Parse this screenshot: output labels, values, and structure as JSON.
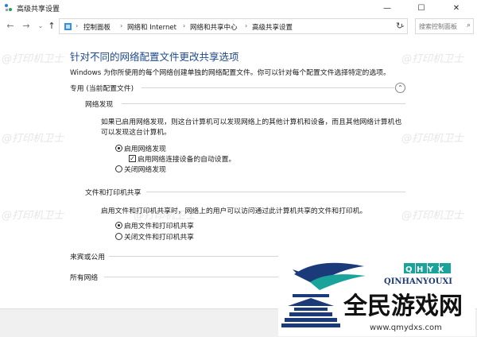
{
  "window": {
    "title": "高级共享设置",
    "minimize": "—",
    "maximize": "☐",
    "close": "✕"
  },
  "nav": {
    "back": "←",
    "forward": "→",
    "recent": "⌄",
    "up": "↑",
    "breadcrumbs": [
      "控制面板",
      "网络和 Internet",
      "网络和共享中心",
      "高级共享设置"
    ],
    "separator": "›",
    "dropdown": "⌄",
    "refresh": "↻",
    "search_placeholder": "搜索控制面板",
    "search_icon": "⌕"
  },
  "main": {
    "heading": "针对不同的网络配置文件更改共享选项",
    "description": "Windows 为你所使用的每个网络创建单独的网络配置文件。你可以针对每个配置文件选择特定的选项。",
    "profile_private": {
      "label": "专用 (当前配置文件)",
      "collapse_icon": "⌃",
      "network_discovery": {
        "label": "网络发现",
        "text_line1": "如果已启用网络发现，则这台计算机可以发现网络上的其他计算机和设备，而且其他网络计算机也",
        "text_line2": "可以发现这台计算机。",
        "opt_on": "启用网络发现",
        "opt_on_selected": true,
        "auto_setup": "启用网络连接设备的自动设置。",
        "auto_setup_checked": true,
        "opt_off": "关闭网络发现"
      },
      "file_printer": {
        "label": "文件和打印机共享",
        "text": "启用文件和打印机共享时，网络上的用户可以访问通过此计算机共享的文件和打印机。",
        "opt_on": "启用文件和打印机共享",
        "opt_on_selected": true,
        "opt_off": "关闭文件和打印机共享"
      }
    },
    "profile_guest": {
      "label": "来宾或公用"
    },
    "profile_all": {
      "label": "所有网络"
    }
  },
  "watermark": "@打印机卫士",
  "logo": {
    "brand_latin": "QHYX",
    "brand_full": "QINHANYOUXI",
    "brand_cn": "全民游戏网",
    "url": "www.qmydxs.com"
  },
  "colors": {
    "heading": "#1e4a8c",
    "logo_blue": "#1b3a7a",
    "logo_teal": "#1aa39a"
  }
}
